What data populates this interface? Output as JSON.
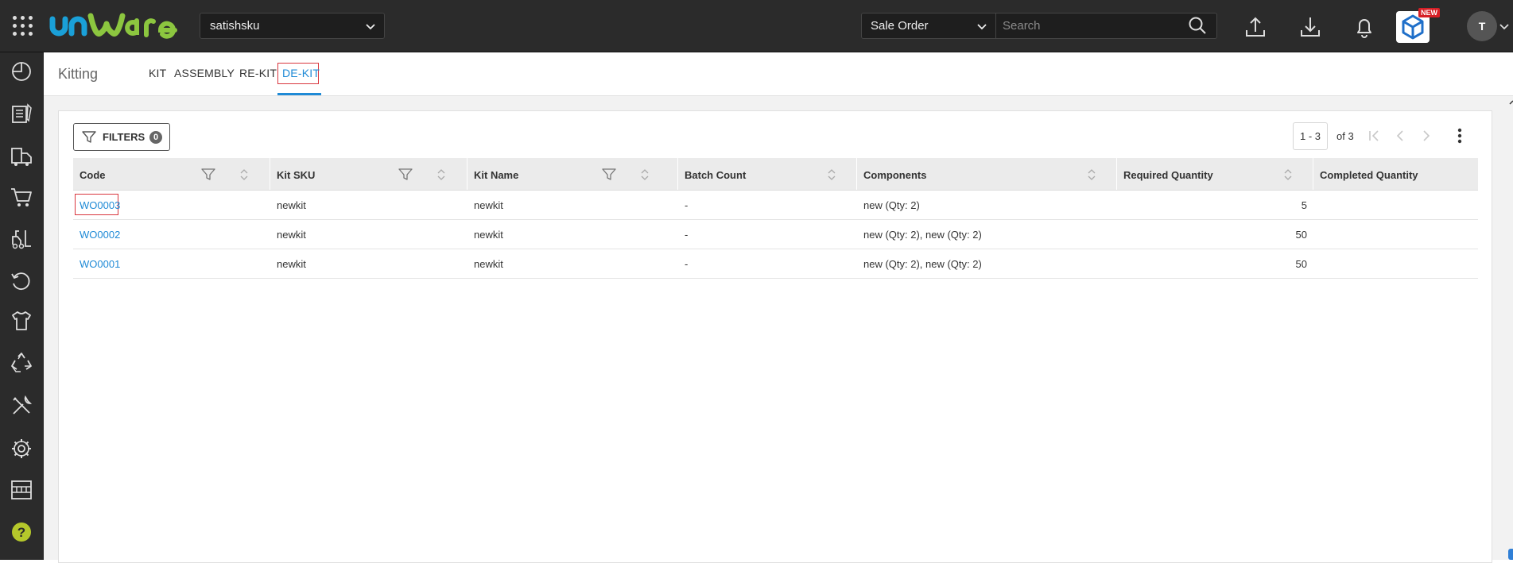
{
  "topbar": {
    "tenant": "satishsku",
    "search_type": "Sale Order",
    "search_placeholder": "Search",
    "new_badge": "NEW",
    "avatar_initial": "T"
  },
  "sidebar": {
    "icons": [
      "dashboard-icon",
      "orders-document-icon",
      "shipping-truck-icon",
      "cart-icon",
      "forklift-icon",
      "returns-icon",
      "tshirt-product-icon",
      "recycle-icon",
      "tools-icon",
      "settings-icon",
      "warehouse-rack-icon",
      "help-icon"
    ]
  },
  "subheader": {
    "title": "Kitting",
    "tabs": [
      "KIT",
      "ASSEMBLY",
      "RE-KIT",
      "DE-KIT"
    ],
    "active_tab": "DE-KIT"
  },
  "toolbar": {
    "filters_label": "FILTERS",
    "filters_count": "0",
    "range": "1 - 3",
    "of_total": "of 3"
  },
  "table": {
    "columns": [
      "Code",
      "Kit SKU",
      "Kit Name",
      "Batch Count",
      "Components",
      "Required Quantity",
      "Completed Quantity"
    ],
    "rows": [
      {
        "code": "WO0003",
        "kit_sku": "newkit",
        "kit_name": "newkit",
        "batch_count": "-",
        "components": "new (Qty: 2)",
        "required_qty": "5",
        "completed_qty": ""
      },
      {
        "code": "WO0002",
        "kit_sku": "newkit",
        "kit_name": "newkit",
        "batch_count": "-",
        "components": "new (Qty: 2), new (Qty: 2)",
        "required_qty": "50",
        "completed_qty": ""
      },
      {
        "code": "WO0001",
        "kit_sku": "newkit",
        "kit_name": "newkit",
        "batch_count": "-",
        "components": "new (Qty: 2), new (Qty: 2)",
        "required_qty": "50",
        "completed_qty": ""
      }
    ]
  },
  "colors": {
    "topbar_bg": "#2b2b2b",
    "accent": "#1f8ad6",
    "highlight_outline": "#d9363e",
    "logo_blue": "#1aa0d8",
    "logo_green": "#8cc63f"
  }
}
